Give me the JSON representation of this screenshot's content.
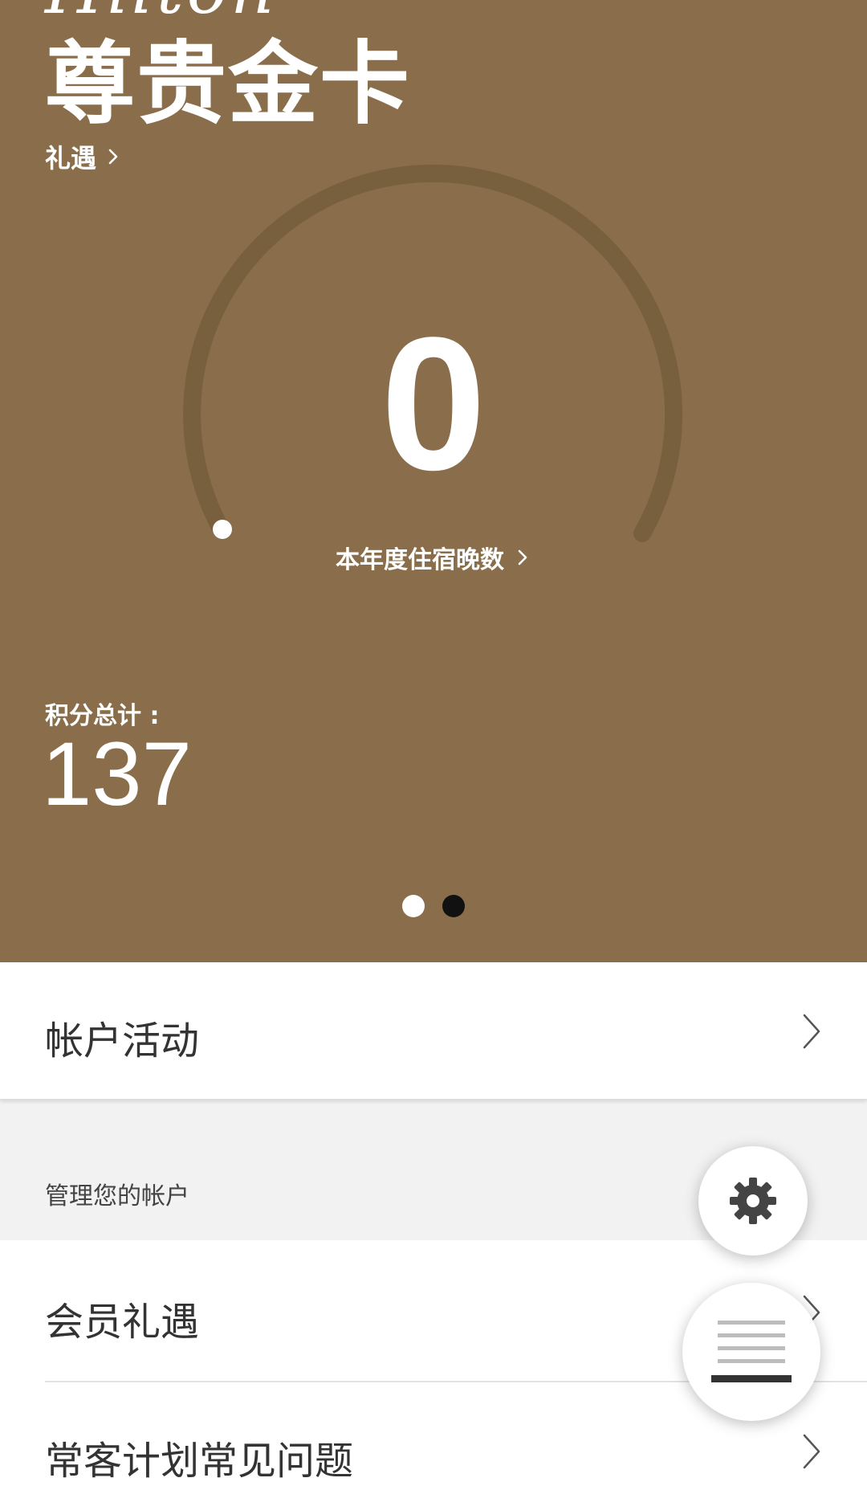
{
  "hero": {
    "brand_script": "Hilton",
    "tier": "尊贵金卡",
    "benefits_link": "礼遇",
    "nights_value": "0",
    "nights_label": "本年度住宿晚数",
    "nights_progress": 0,
    "points_label": "积分总计 :",
    "points_value": "137",
    "pager_total": 2,
    "pager_active": 2,
    "background_color": "#8a6e4b"
  },
  "list": {
    "activity_label": "帐户活动",
    "manage_section_title": "管理您的帐户",
    "member_benefits_label": "会员礼遇",
    "faq_label": "常客计划常见问题"
  },
  "icons": {
    "settings": "gear-icon",
    "menu": "menu-icon",
    "chevron": "chevron-right-icon"
  }
}
